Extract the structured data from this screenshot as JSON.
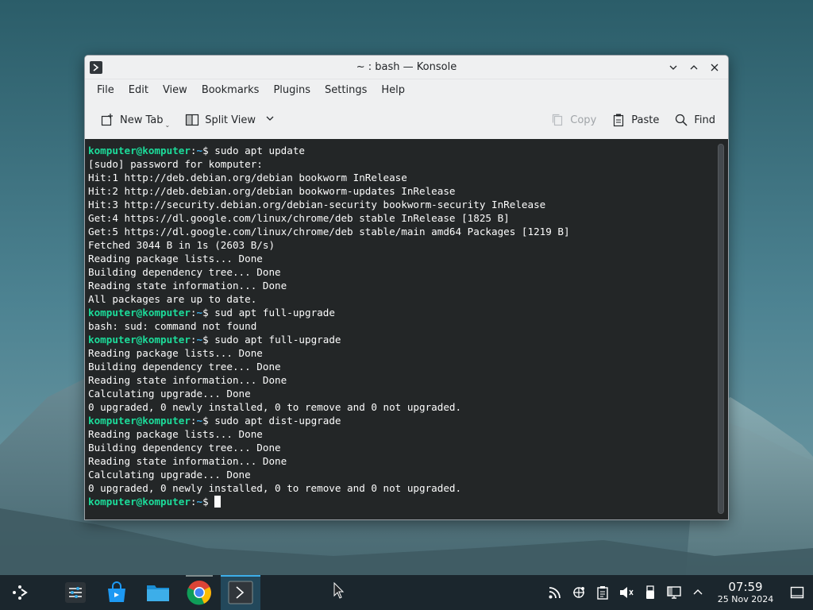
{
  "window": {
    "title": "~ : bash — Konsole",
    "controls": [
      "minimize",
      "maximize",
      "close"
    ]
  },
  "menubar": {
    "items": [
      "File",
      "Edit",
      "View",
      "Bookmarks",
      "Plugins",
      "Settings",
      "Help"
    ]
  },
  "toolbar": {
    "new_tab": "New Tab",
    "split_view": "Split View",
    "copy": "Copy",
    "paste": "Paste",
    "find": "Find"
  },
  "prompt": {
    "user_host": "komputer@komputer",
    "separator": ":",
    "path": "~",
    "symbol": "$"
  },
  "terminal": {
    "lines": [
      {
        "type": "prompt",
        "cmd": " sudo apt update"
      },
      {
        "type": "out",
        "text": "[sudo] password for komputer:"
      },
      {
        "type": "out",
        "text": "Hit:1 http://deb.debian.org/debian bookworm InRelease"
      },
      {
        "type": "out",
        "text": "Hit:2 http://deb.debian.org/debian bookworm-updates InRelease"
      },
      {
        "type": "out",
        "text": "Hit:3 http://security.debian.org/debian-security bookworm-security InRelease"
      },
      {
        "type": "out",
        "text": "Get:4 https://dl.google.com/linux/chrome/deb stable InRelease [1825 B]"
      },
      {
        "type": "out",
        "text": "Get:5 https://dl.google.com/linux/chrome/deb stable/main amd64 Packages [1219 B]"
      },
      {
        "type": "out",
        "text": "Fetched 3044 B in 1s (2603 B/s)"
      },
      {
        "type": "out",
        "text": "Reading package lists... Done"
      },
      {
        "type": "out",
        "text": "Building dependency tree... Done"
      },
      {
        "type": "out",
        "text": "Reading state information... Done"
      },
      {
        "type": "out",
        "text": "All packages are up to date."
      },
      {
        "type": "prompt",
        "cmd": " sud apt full-upgrade"
      },
      {
        "type": "out",
        "text": "bash: sud: command not found"
      },
      {
        "type": "prompt",
        "cmd": " sudo apt full-upgrade"
      },
      {
        "type": "out",
        "text": "Reading package lists... Done"
      },
      {
        "type": "out",
        "text": "Building dependency tree... Done"
      },
      {
        "type": "out",
        "text": "Reading state information... Done"
      },
      {
        "type": "out",
        "text": "Calculating upgrade... Done"
      },
      {
        "type": "out",
        "text": "0 upgraded, 0 newly installed, 0 to remove and 0 not upgraded."
      },
      {
        "type": "prompt",
        "cmd": " sudo apt dist-upgrade"
      },
      {
        "type": "out",
        "text": "Reading package lists... Done"
      },
      {
        "type": "out",
        "text": "Building dependency tree... Done"
      },
      {
        "type": "out",
        "text": "Reading state information... Done"
      },
      {
        "type": "out",
        "text": "Calculating upgrade... Done"
      },
      {
        "type": "out",
        "text": "0 upgraded, 0 newly installed, 0 to remove and 0 not upgraded."
      },
      {
        "type": "prompt",
        "cmd": " ",
        "cursor": true
      }
    ]
  },
  "taskbar": {
    "launchers": [
      {
        "name": "application-launcher",
        "icon": "kde-launcher-icon",
        "state": "idle"
      },
      {
        "name": "system-settings",
        "icon": "settings-sliders-icon",
        "state": "idle"
      },
      {
        "name": "discover",
        "icon": "store-bag-icon",
        "state": "idle"
      },
      {
        "name": "dolphin",
        "icon": "folder-icon",
        "state": "idle"
      },
      {
        "name": "google-chrome",
        "icon": "chrome-icon",
        "state": "running"
      },
      {
        "name": "konsole",
        "icon": "terminal-icon",
        "state": "active"
      }
    ],
    "tray": [
      "rss-feed-icon",
      "network-icon",
      "clipboard-icon",
      "volume-muted-icon",
      "usb-device-icon",
      "display-icon",
      "expand-tray-icon"
    ],
    "clock": {
      "time": "07:59",
      "date": "25 Nov 2024"
    }
  },
  "colors": {
    "prompt_user": "#1cdc9a",
    "prompt_path": "#3daee9",
    "terminal_bg": "#232627",
    "terminal_fg": "#fcfcfc",
    "accent": "#3daee9"
  }
}
